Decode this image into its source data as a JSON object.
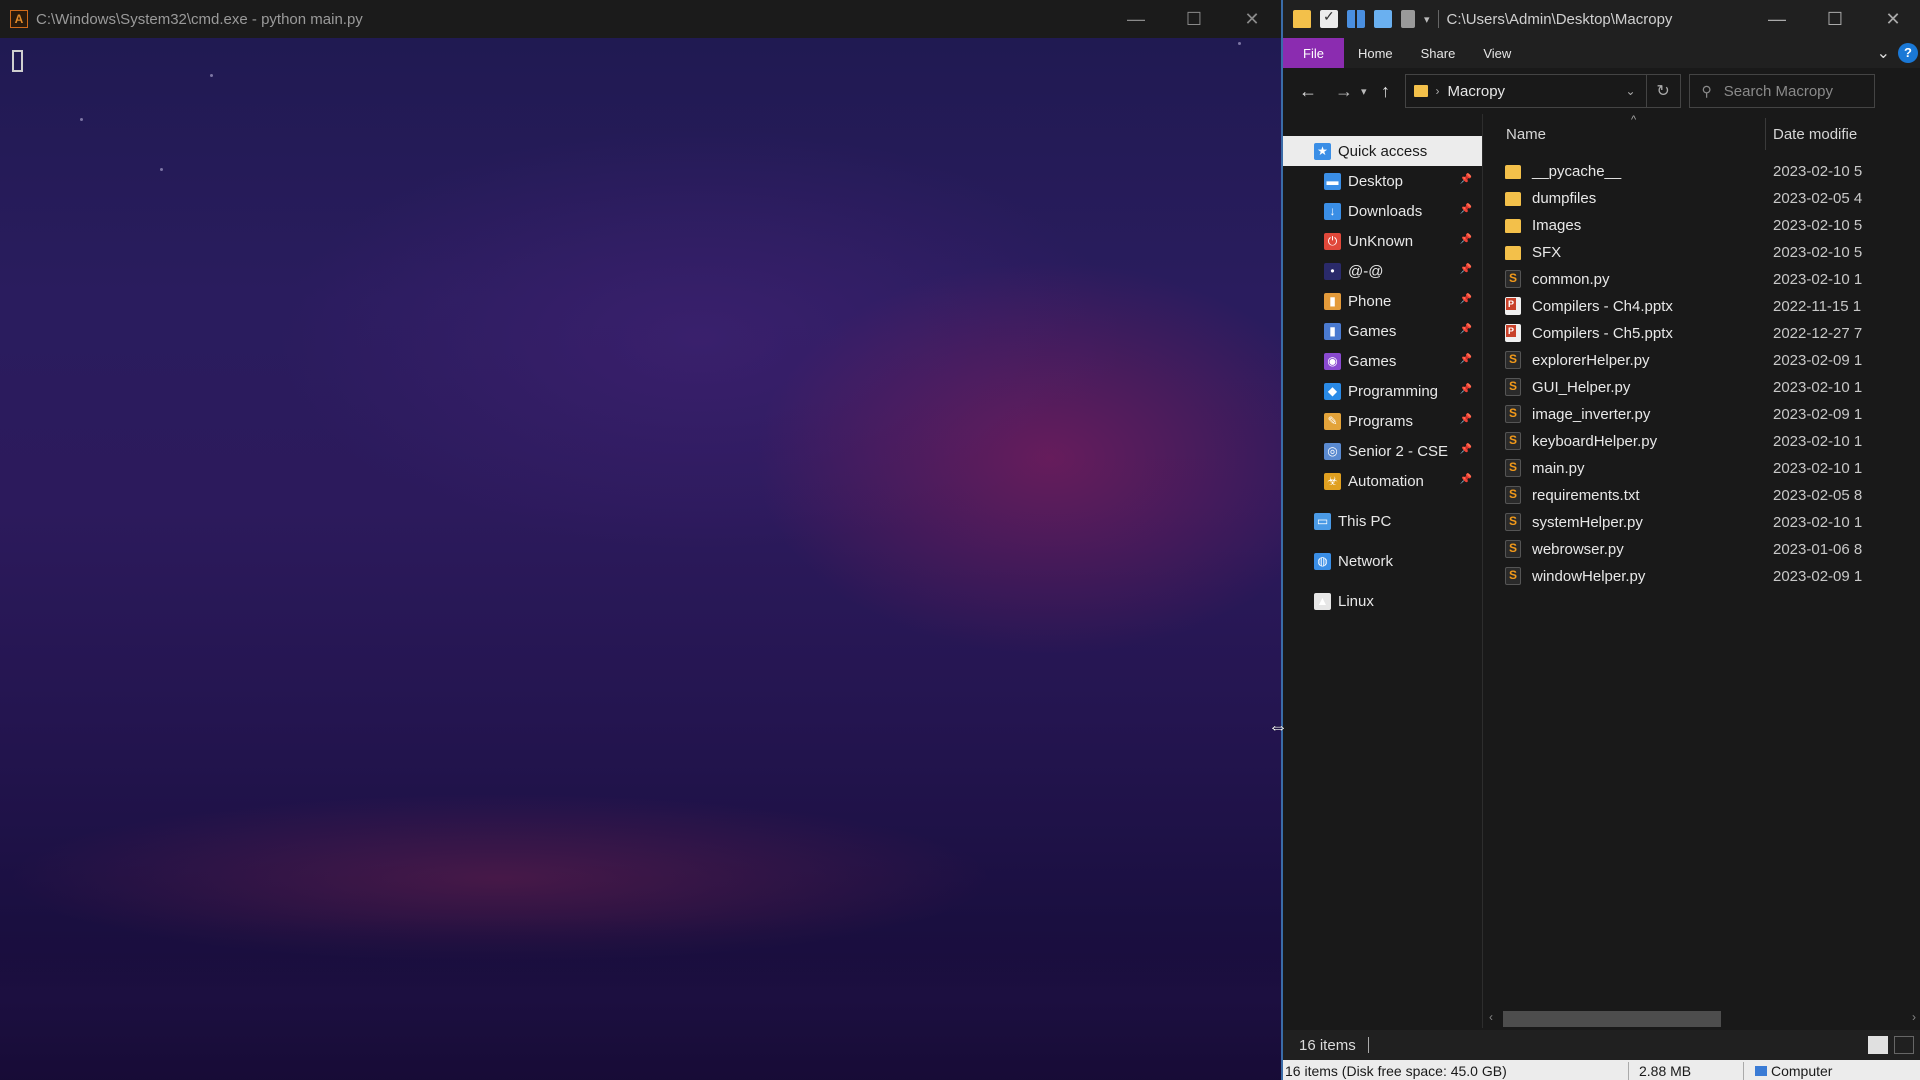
{
  "cmd": {
    "title": "C:\\Windows\\System32\\cmd.exe - python  main.py",
    "minimize_glyph": "—",
    "maximize_glyph": "☐",
    "close_glyph": "✕"
  },
  "explorer": {
    "title": "C:\\Users\\Admin\\Desktop\\Macropy",
    "ribbon_tabs": [
      "File",
      "Home",
      "Share",
      "View"
    ],
    "address": "Macropy",
    "search_placeholder": "Search Macropy",
    "nav_items": [
      {
        "label": "Quick access",
        "icon": "star-icon",
        "color": "#3a8ee6",
        "selected": true,
        "pinned": false
      },
      {
        "label": "Desktop",
        "icon": "desktop-icon",
        "color": "#3a8ee6",
        "pinned": true
      },
      {
        "label": "Downloads",
        "icon": "download-icon",
        "color": "#3a8ee6",
        "pinned": true
      },
      {
        "label": "UnKnown",
        "icon": "power-icon",
        "color": "#e0483a",
        "pinned": true
      },
      {
        "label": "@-@",
        "icon": "dot-icon",
        "color": "#2a2a6a",
        "pinned": true
      },
      {
        "label": "Phone",
        "icon": "phone-icon",
        "color": "#e39a3a",
        "pinned": true
      },
      {
        "label": "Games",
        "icon": "gamepad-icon",
        "color": "#4a7ad0",
        "pinned": true
      },
      {
        "label": "Games",
        "icon": "game-icon-alt",
        "color": "#8a4ad0",
        "pinned": true
      },
      {
        "label": "Programming",
        "icon": "vscode-icon",
        "color": "#2a8ae6",
        "pinned": true
      },
      {
        "label": "Programs",
        "icon": "programs-icon",
        "color": "#e3a33a",
        "pinned": true
      },
      {
        "label": "Senior 2 - CSE",
        "icon": "globe-icon",
        "color": "#5a8ad0",
        "pinned": true
      },
      {
        "label": "Automation",
        "icon": "biohazard-icon",
        "color": "#e0a020",
        "pinned": true
      },
      {
        "label": "This PC",
        "icon": "computer-icon",
        "color": "#4a9ae6",
        "pinned": false
      },
      {
        "label": "Network",
        "icon": "network-icon",
        "color": "#3a8ee6",
        "pinned": false
      },
      {
        "label": "Linux",
        "icon": "penguin-icon",
        "color": "#e6e6e6",
        "pinned": false
      }
    ],
    "columns": {
      "name": "Name",
      "date": "Date modifie"
    },
    "files": [
      {
        "name": "__pycache__",
        "type": "folder",
        "date": "2023-02-10 5"
      },
      {
        "name": "dumpfiles",
        "type": "folder",
        "date": "2023-02-05 4"
      },
      {
        "name": "Images",
        "type": "folder",
        "date": "2023-02-10 5"
      },
      {
        "name": "SFX",
        "type": "folder",
        "date": "2023-02-10 5"
      },
      {
        "name": "common.py",
        "type": "py",
        "date": "2023-02-10 1"
      },
      {
        "name": "Compilers - Ch4.pptx",
        "type": "pptx",
        "date": "2022-11-15 1"
      },
      {
        "name": "Compilers - Ch5.pptx",
        "type": "pptx",
        "date": "2022-12-27 7"
      },
      {
        "name": "explorerHelper.py",
        "type": "py",
        "date": "2023-02-09 1"
      },
      {
        "name": "GUI_Helper.py",
        "type": "py",
        "date": "2023-02-10 1"
      },
      {
        "name": "image_inverter.py",
        "type": "py",
        "date": "2023-02-09 1"
      },
      {
        "name": "keyboardHelper.py",
        "type": "py",
        "date": "2023-02-10 1"
      },
      {
        "name": "main.py",
        "type": "py",
        "date": "2023-02-10 1"
      },
      {
        "name": "requirements.txt",
        "type": "py",
        "date": "2023-02-05 8"
      },
      {
        "name": "systemHelper.py",
        "type": "py",
        "date": "2023-02-10 1"
      },
      {
        "name": "webrowser.py",
        "type": "py",
        "date": "2023-01-06 8"
      },
      {
        "name": "windowHelper.py",
        "type": "py",
        "date": "2023-02-09 1"
      }
    ],
    "status_count": "16 items",
    "outer_status": {
      "items": "16 items (Disk free space: 45.0 GB)",
      "size": "2.88 MB",
      "location": "Computer"
    }
  }
}
